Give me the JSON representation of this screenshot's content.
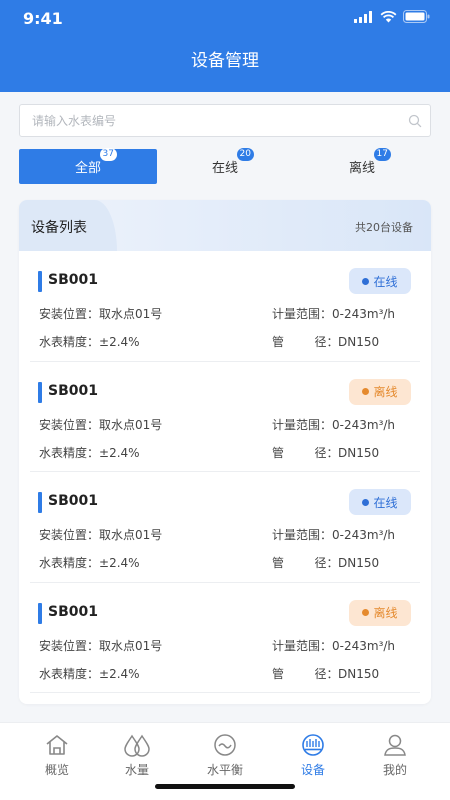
{
  "status_bar": {
    "time": "9:41"
  },
  "header": {
    "title": "设备管理"
  },
  "search": {
    "placeholder": "请输入水表编号",
    "value": ""
  },
  "filter_tabs": [
    {
      "label": "全部",
      "count": "37",
      "active": true
    },
    {
      "label": "在线",
      "count": "20",
      "active": false
    },
    {
      "label": "离线",
      "count": "17",
      "active": false
    }
  ],
  "device_panel": {
    "title": "设备列表",
    "total": "共20台设备"
  },
  "devices": [
    {
      "id": "SB001",
      "status": "在线",
      "status_type": "online",
      "location_label": "安装位置：",
      "location": "取水点01号",
      "range_label": "计量范围：",
      "range": "0-243m³/h",
      "accuracy_label": "水表精度：",
      "accuracy": "±2.4%",
      "pipe_label": "管        径：",
      "pipe": "DN150"
    },
    {
      "id": "SB001",
      "status": "离线",
      "status_type": "offline",
      "location_label": "安装位置：",
      "location": "取水点01号",
      "range_label": "计量范围：",
      "range": "0-243m³/h",
      "accuracy_label": "水表精度：",
      "accuracy": "±2.4%",
      "pipe_label": "管        径：",
      "pipe": "DN150"
    },
    {
      "id": "SB001",
      "status": "在线",
      "status_type": "online",
      "location_label": "安装位置：",
      "location": "取水点01号",
      "range_label": "计量范围：",
      "range": "0-243m³/h",
      "accuracy_label": "水表精度：",
      "accuracy": "±2.4%",
      "pipe_label": "管        径：",
      "pipe": "DN150"
    },
    {
      "id": "SB001",
      "status": "离线",
      "status_type": "offline",
      "location_label": "安装位置：",
      "location": "取水点01号",
      "range_label": "计量范围：",
      "range": "0-243m³/h",
      "accuracy_label": "水表精度：",
      "accuracy": "±2.4%",
      "pipe_label": "管        径：",
      "pipe": "DN150"
    }
  ],
  "tabbar": [
    {
      "label": "概览",
      "icon": "home-icon",
      "active": false
    },
    {
      "label": "水量",
      "icon": "water-drops-icon",
      "active": false
    },
    {
      "label": "水平衡",
      "icon": "balance-wave-icon",
      "active": false
    },
    {
      "label": "设备",
      "icon": "device-meter-icon",
      "active": true
    },
    {
      "label": "我的",
      "icon": "user-icon",
      "active": false
    }
  ],
  "colors": {
    "primary": "#2f7ce6",
    "online": "#2f6fd6",
    "offline": "#e58a2e"
  }
}
